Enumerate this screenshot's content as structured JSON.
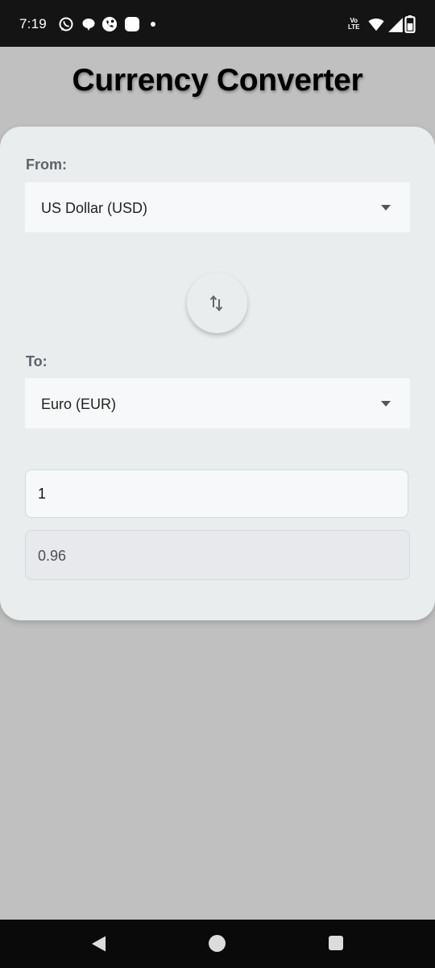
{
  "status_bar": {
    "time": "7:19",
    "network_label_top": "Vo",
    "network_label_bottom": "LTE",
    "icons": [
      "whatsapp-icon",
      "chat-bubble-icon",
      "phone-message-icon",
      "square-notification-icon",
      "dot-icon",
      "wifi-icon",
      "signal-icon",
      "battery-icon"
    ]
  },
  "header": {
    "title": "Currency Converter"
  },
  "converter": {
    "from_label": "From:",
    "from_value": "US Dollar (USD)",
    "to_label": "To:",
    "to_value": "Euro (EUR)",
    "swap_icon": "swap-vertical-icon",
    "amount_value": "1",
    "result_value": "0.96"
  },
  "nav_bar": {
    "icons": [
      "back-icon",
      "home-icon",
      "recents-icon"
    ]
  },
  "colors": {
    "background": "#c0c0c0",
    "card": "#eaedee",
    "field": "#f7f8fa",
    "label": "#5f6266",
    "system_bar": "#141414"
  }
}
